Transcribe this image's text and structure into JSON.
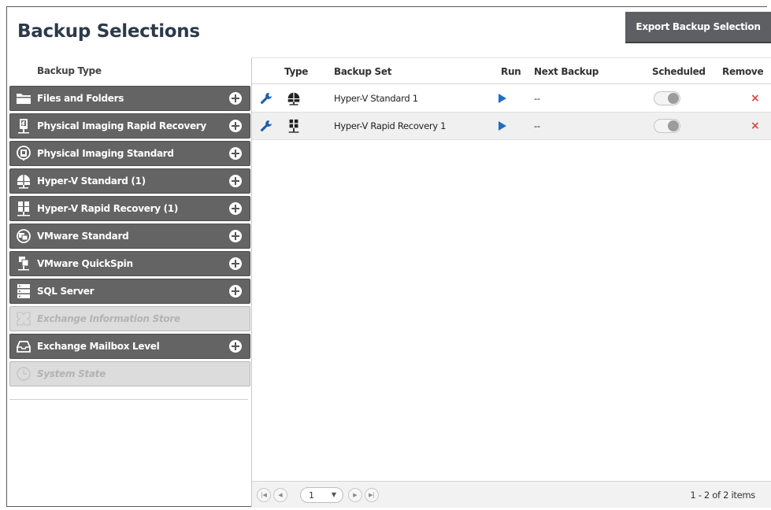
{
  "header": {
    "title": "Backup Selections",
    "export_label": "Export Backup Selection"
  },
  "left_panel": {
    "heading": "Backup Type",
    "types": [
      {
        "label": "Files and Folders",
        "icon": "folder-icon",
        "enabled": true
      },
      {
        "label": "Physical Imaging Rapid Recovery",
        "icon": "physical-rapid-recovery-icon",
        "enabled": true
      },
      {
        "label": "Physical Imaging Standard",
        "icon": "physical-standard-icon",
        "enabled": true
      },
      {
        "label": "Hyper-V Standard (1)",
        "icon": "hyperv-standard-icon",
        "enabled": true
      },
      {
        "label": "Hyper-V Rapid Recovery (1)",
        "icon": "hyperv-rapid-recovery-icon",
        "enabled": true
      },
      {
        "label": "VMware Standard",
        "icon": "vmware-standard-icon",
        "enabled": true
      },
      {
        "label": "VMware QuickSpin",
        "icon": "vmware-quickspin-icon",
        "enabled": true
      },
      {
        "label": "SQL Server",
        "icon": "sql-server-icon",
        "enabled": true
      },
      {
        "label": "Exchange Information Store",
        "icon": "exchange-store-icon",
        "enabled": false
      },
      {
        "label": "Exchange Mailbox Level",
        "icon": "mailbox-icon",
        "enabled": true
      },
      {
        "label": "System State",
        "icon": "clock-icon",
        "enabled": false
      }
    ]
  },
  "grid": {
    "columns": {
      "type": "Type",
      "backup_set": "Backup Set",
      "run": "Run",
      "next_backup": "Next Backup",
      "scheduled": "Scheduled",
      "remove": "Remove"
    },
    "rows": [
      {
        "type_icon": "hyperv-standard-icon",
        "backup_set": "Hyper-V Standard 1",
        "next_backup": "--",
        "scheduled": false
      },
      {
        "type_icon": "hyperv-rapid-recovery-icon",
        "backup_set": "Hyper-V Rapid Recovery 1",
        "next_backup": "--",
        "scheduled": false
      }
    ],
    "remove_symbol": "×",
    "pager": {
      "page": "1",
      "summary": "1 - 2 of 2 items"
    }
  },
  "colors": {
    "type_button_bg": "#646464",
    "title": "#2c3a4b",
    "run_arrow": "#1f6fc2",
    "wrench": "#1f5fb0",
    "remove": "#e0423f"
  }
}
